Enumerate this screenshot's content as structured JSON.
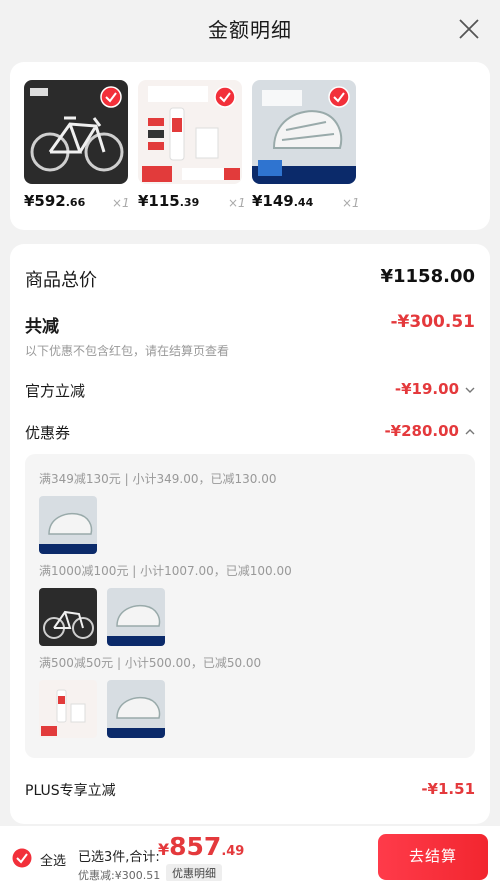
{
  "header": {
    "title": "金额明细"
  },
  "products": [
    {
      "price_int": "¥592",
      "price_dec": ".66",
      "qty": "×1",
      "icon": "bike-image"
    },
    {
      "price_int": "¥115",
      "price_dec": ".39",
      "qty": "×1",
      "icon": "product-image"
    },
    {
      "price_int": "¥149",
      "price_dec": ".44",
      "qty": "×1",
      "icon": "helmet-image"
    }
  ],
  "summary": {
    "total_label": "商品总价",
    "total_value": "¥1158.00",
    "saved_label": "共减",
    "saved_value": "-¥300.51",
    "saved_note": "以下优惠不包含红包，请在结算页查看",
    "official_label": "官方立减",
    "official_value": "-¥19.00",
    "coupon_label": "优惠券",
    "coupon_value": "-¥280.00",
    "plus_label": "PLUS专享立减",
    "plus_value": "-¥1.51"
  },
  "coupons": [
    {
      "label": "满349减130元 | 小计349.00，已减130.00"
    },
    {
      "label": "满1000减100元 | 小计1007.00，已减100.00"
    },
    {
      "label": "满500减50元 | 小计500.00，已减50.00"
    }
  ],
  "bottom": {
    "select_all": "全选",
    "summary": "已选3件,合计:",
    "currency": "¥",
    "total_int": "857",
    "total_dec": ".49",
    "discount": "优惠减:¥300.51",
    "detail_tag": "优惠明细",
    "checkout": "去结算"
  },
  "colors": {
    "accent": "#e4393c",
    "check": "#f2303a",
    "background": "#f2f2f2"
  }
}
